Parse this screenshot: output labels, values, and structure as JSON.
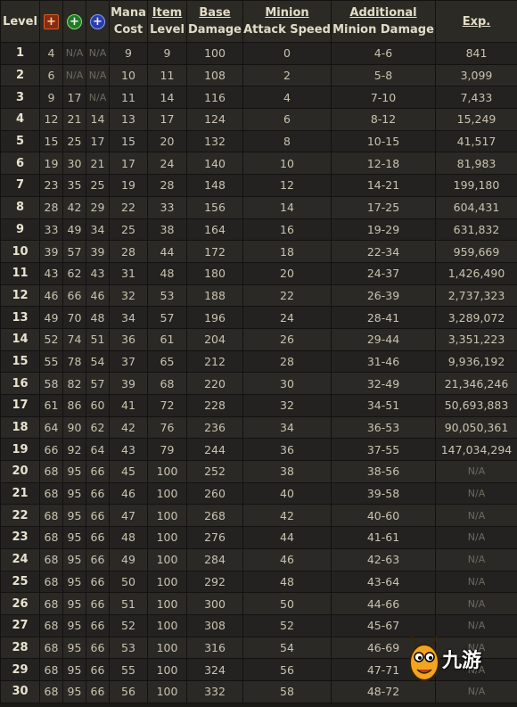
{
  "headers": {
    "level": "Level",
    "str_icon": "+",
    "dex_icon": "+",
    "int_icon": "+",
    "mana_cost": [
      "Mana",
      "Cost"
    ],
    "item_level": [
      "Item",
      "Level"
    ],
    "base_damage": [
      "Base",
      "Damage"
    ],
    "minion_attack_speed": [
      "Minion",
      "Attack Speed"
    ],
    "additional_minion_damage": [
      "Additional",
      "Minion Damage"
    ],
    "exp": "Exp."
  },
  "icons": {
    "str": "strength-attribute-icon",
    "dex": "dexterity-attribute-icon",
    "int": "intelligence-attribute-icon"
  },
  "colors": {
    "strength": "#8a2a12",
    "dexterity": "#1f7a2a",
    "intelligence": "#2a3da8"
  },
  "rows": [
    [
      "1",
      "4",
      "N/A",
      "N/A",
      "9",
      "9",
      "100",
      "0",
      "4-6",
      "841"
    ],
    [
      "2",
      "6",
      "N/A",
      "N/A",
      "10",
      "11",
      "108",
      "2",
      "5-8",
      "3,099"
    ],
    [
      "3",
      "9",
      "17",
      "N/A",
      "11",
      "14",
      "116",
      "4",
      "7-10",
      "7,433"
    ],
    [
      "4",
      "12",
      "21",
      "14",
      "13",
      "17",
      "124",
      "6",
      "8-12",
      "15,249"
    ],
    [
      "5",
      "15",
      "25",
      "17",
      "15",
      "20",
      "132",
      "8",
      "10-15",
      "41,517"
    ],
    [
      "6",
      "19",
      "30",
      "21",
      "17",
      "24",
      "140",
      "10",
      "12-18",
      "81,983"
    ],
    [
      "7",
      "23",
      "35",
      "25",
      "19",
      "28",
      "148",
      "12",
      "14-21",
      "199,180"
    ],
    [
      "8",
      "28",
      "42",
      "29",
      "22",
      "33",
      "156",
      "14",
      "17-25",
      "604,431"
    ],
    [
      "9",
      "33",
      "49",
      "34",
      "25",
      "38",
      "164",
      "16",
      "19-29",
      "631,832"
    ],
    [
      "10",
      "39",
      "57",
      "39",
      "28",
      "44",
      "172",
      "18",
      "22-34",
      "959,669"
    ],
    [
      "11",
      "43",
      "62",
      "43",
      "31",
      "48",
      "180",
      "20",
      "24-37",
      "1,426,490"
    ],
    [
      "12",
      "46",
      "66",
      "46",
      "32",
      "53",
      "188",
      "22",
      "26-39",
      "2,737,323"
    ],
    [
      "13",
      "49",
      "70",
      "48",
      "34",
      "57",
      "196",
      "24",
      "28-41",
      "3,289,072"
    ],
    [
      "14",
      "52",
      "74",
      "51",
      "36",
      "61",
      "204",
      "26",
      "29-44",
      "3,351,223"
    ],
    [
      "15",
      "55",
      "78",
      "54",
      "37",
      "65",
      "212",
      "28",
      "31-46",
      "9,936,192"
    ],
    [
      "16",
      "58",
      "82",
      "57",
      "39",
      "68",
      "220",
      "30",
      "32-49",
      "21,346,246"
    ],
    [
      "17",
      "61",
      "86",
      "60",
      "41",
      "72",
      "228",
      "32",
      "34-51",
      "50,693,883"
    ],
    [
      "18",
      "64",
      "90",
      "62",
      "42",
      "76",
      "236",
      "34",
      "36-53",
      "90,050,361"
    ],
    [
      "19",
      "66",
      "92",
      "64",
      "43",
      "79",
      "244",
      "36",
      "37-55",
      "147,034,294"
    ],
    [
      "20",
      "68",
      "95",
      "66",
      "45",
      "100",
      "252",
      "38",
      "38-56",
      "N/A"
    ],
    [
      "21",
      "68",
      "95",
      "66",
      "46",
      "100",
      "260",
      "40",
      "39-58",
      "N/A"
    ],
    [
      "22",
      "68",
      "95",
      "66",
      "47",
      "100",
      "268",
      "42",
      "40-60",
      "N/A"
    ],
    [
      "23",
      "68",
      "95",
      "66",
      "48",
      "100",
      "276",
      "44",
      "41-61",
      "N/A"
    ],
    [
      "24",
      "68",
      "95",
      "66",
      "49",
      "100",
      "284",
      "46",
      "42-63",
      "N/A"
    ],
    [
      "25",
      "68",
      "95",
      "66",
      "50",
      "100",
      "292",
      "48",
      "43-64",
      "N/A"
    ],
    [
      "26",
      "68",
      "95",
      "66",
      "51",
      "100",
      "300",
      "50",
      "44-66",
      "N/A"
    ],
    [
      "27",
      "68",
      "95",
      "66",
      "52",
      "100",
      "308",
      "52",
      "45-67",
      "N/A"
    ],
    [
      "28",
      "68",
      "95",
      "66",
      "53",
      "100",
      "316",
      "54",
      "46-69",
      "N/A"
    ],
    [
      "29",
      "68",
      "95",
      "66",
      "55",
      "100",
      "324",
      "56",
      "47-71",
      "N/A"
    ],
    [
      "30",
      "68",
      "95",
      "66",
      "56",
      "100",
      "332",
      "58",
      "48-72",
      "N/A"
    ]
  ],
  "watermark": {
    "text": "九游",
    "icon": "mascot-logo-icon"
  }
}
